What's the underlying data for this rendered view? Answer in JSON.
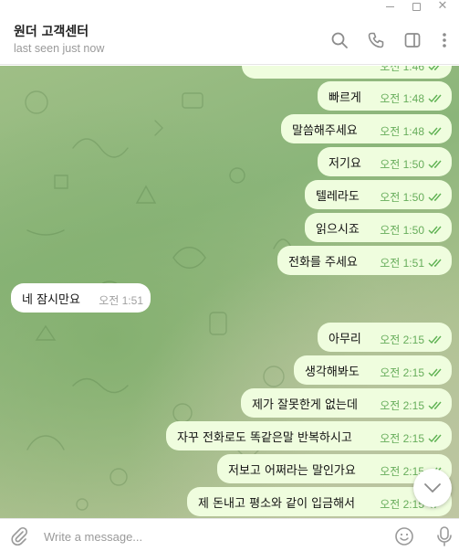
{
  "window": {
    "minimize_icon": "minimize-icon",
    "maximize_icon": "maximize-icon",
    "close_glyph": "✕"
  },
  "header": {
    "title": "원더 고객센터",
    "status": "last seen just now",
    "icons": [
      "search-icon",
      "phone-icon",
      "sidebar-toggle-icon",
      "more-vertical-icon"
    ]
  },
  "messages": [
    {
      "text": "",
      "time": "오전 1:46",
      "outgoing": true,
      "read": true
    },
    {
      "text": "빠르게",
      "time": "오전 1:48",
      "outgoing": true,
      "read": true
    },
    {
      "text": "말씀해주세요",
      "time": "오전 1:48",
      "outgoing": true,
      "read": true
    },
    {
      "text": "저기요",
      "time": "오전 1:50",
      "outgoing": true,
      "read": true
    },
    {
      "text": "텔레라도",
      "time": "오전 1:50",
      "outgoing": true,
      "read": true
    },
    {
      "text": "읽으시죠",
      "time": "오전 1:50",
      "outgoing": true,
      "read": true
    },
    {
      "text": "전화를 주세요",
      "time": "오전 1:51",
      "outgoing": true,
      "read": true
    },
    {
      "text": "네 잠시만요",
      "time": "오전 1:51",
      "outgoing": false,
      "read": false
    },
    {
      "text": "아무리",
      "time": "오전 2:15",
      "outgoing": true,
      "read": true
    },
    {
      "text": "생각해봐도",
      "time": "오전 2:15",
      "outgoing": true,
      "read": true
    },
    {
      "text": "제가 잘못한게 없는데",
      "time": "오전 2:15",
      "outgoing": true,
      "read": true
    },
    {
      "text": "자꾸 전화로도 똑같은말 반복하시고",
      "time": "오전 2:15",
      "outgoing": true,
      "read": true
    },
    {
      "text": "저보고 어쩌라는 말인가요",
      "time": "오전 2:15",
      "outgoing": true,
      "read": true
    },
    {
      "text": "제 돈내고 평소와 같이 입금해서",
      "time": "오전 2:15",
      "outgoing": true,
      "read": true
    }
  ],
  "composer": {
    "placeholder": "Write a message...",
    "value": "",
    "icons": [
      "paperclip-icon",
      "emoji-icon",
      "microphone-icon"
    ]
  },
  "scroll_button_icon": "chevron-down-icon",
  "colors": {
    "outgoing_bubble": "#effdde",
    "incoming_bubble": "#ffffff",
    "outgoing_meta": "#67ad5b",
    "incoming_meta": "#a0a0a0"
  }
}
